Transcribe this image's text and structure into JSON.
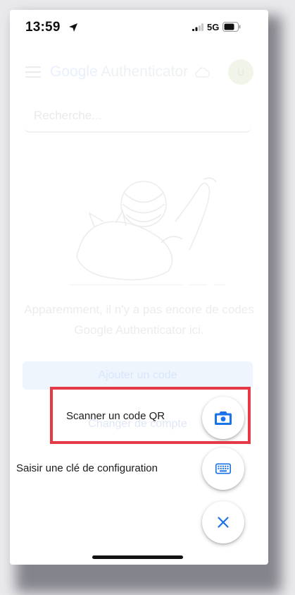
{
  "status_bar": {
    "time": "13:59",
    "network": "5G"
  },
  "app": {
    "brand_google": "Google",
    "brand_product": " Authenticator",
    "avatar_initials": "U",
    "search_placeholder": "Recherche...",
    "empty_message": "Apparemment, il n'y a pas encore de codes Google Authenticator ici.",
    "add_code_label": "Ajouter un code",
    "switch_account_label": "Changer de compte"
  },
  "speed_dial": {
    "scan_label": "Scanner un code QR",
    "scan_icon": "camera-icon",
    "key_label": "Saisir une clé de configuration",
    "key_icon": "keyboard-icon",
    "close_icon": "close-icon"
  },
  "colors": {
    "accent": "#1a73e8",
    "highlight": "#e53a45"
  }
}
